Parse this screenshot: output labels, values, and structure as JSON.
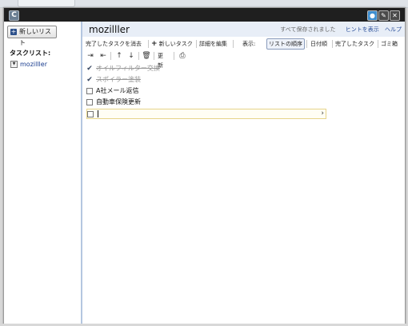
{
  "window": {
    "app_icon": "C",
    "buttons": {
      "minimize": "●",
      "pin": "✎",
      "close": "✕"
    }
  },
  "sidebar": {
    "new_list_label": "新しいリスト",
    "heading": "タスクリスト:",
    "lists": [
      {
        "label": "mozilller"
      }
    ]
  },
  "header": {
    "list_title": "mozilller",
    "saved_status": "すべて保存されました",
    "links": [
      "ヒントを表示",
      "ヘルプ"
    ]
  },
  "toolbar": {
    "clear_completed": "完了したタスクを消去",
    "new_task": "新しいタスク",
    "edit_details": "詳細を編集",
    "view_label": "表示:",
    "views": [
      "リストの順序",
      "日付順",
      "完了したタスク",
      "ゴミ箱"
    ],
    "active_view": "リストの順序",
    "refresh": "更新",
    "icons": [
      "indent-icon",
      "outdent-icon",
      "move-up-icon",
      "move-down-icon",
      "trash-icon",
      "print-icon"
    ]
  },
  "tasks": [
    {
      "title": "オイルフィルター交換",
      "done": true
    },
    {
      "title": "スポイラー塗装",
      "done": true
    },
    {
      "title": "A社メール返信",
      "done": false
    },
    {
      "title": "自動車保険更新",
      "done": false
    },
    {
      "title": "",
      "done": false,
      "editing": true
    }
  ],
  "colors": {
    "titlebar": "#1f1f1f",
    "header_band": "#e8eef7",
    "link": "#2a4f9a",
    "sidebar_border": "#b4c6e0"
  }
}
